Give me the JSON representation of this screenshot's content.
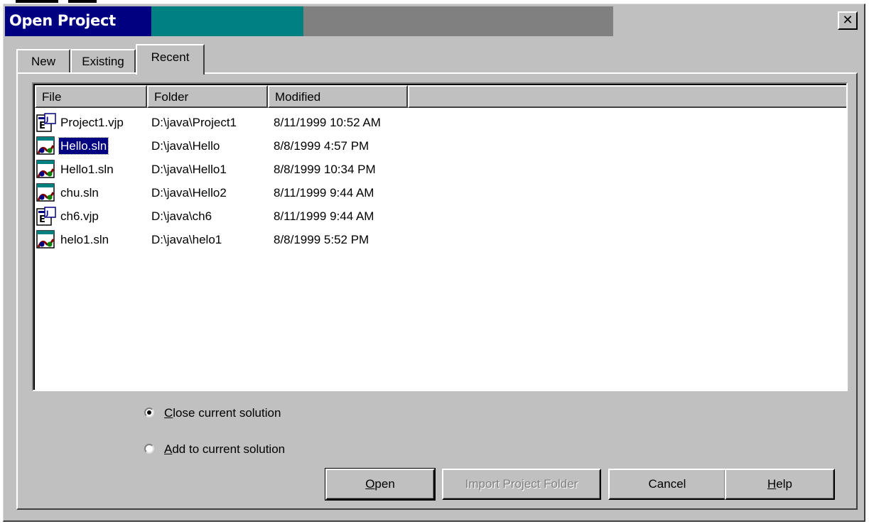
{
  "window": {
    "title": "Open Project",
    "close_glyph": "✕",
    "title_colors": [
      "#000080",
      "#008080",
      "#808080"
    ]
  },
  "tabs": [
    {
      "label": "New",
      "active": false
    },
    {
      "label": "Existing",
      "active": false
    },
    {
      "label": "Recent",
      "active": true
    }
  ],
  "list": {
    "columns": [
      "File",
      "Folder",
      "Modified"
    ],
    "rows": [
      {
        "file": "Project1.vjp",
        "folder": "D:\\java\\Project1",
        "modified": "8/11/1999 10:52 AM",
        "icon": "vjp-project-icon",
        "selected": false
      },
      {
        "file": "Hello.sln",
        "folder": "D:\\java\\Hello",
        "modified": "8/8/1999 4:57 PM",
        "icon": "solution-icon",
        "selected": true
      },
      {
        "file": "Hello1.sln",
        "folder": "D:\\java\\Hello1",
        "modified": "8/8/1999 10:34 PM",
        "icon": "solution-icon",
        "selected": false
      },
      {
        "file": "chu.sln",
        "folder": "D:\\java\\Hello2",
        "modified": "8/11/1999 9:44 AM",
        "icon": "solution-icon",
        "selected": false
      },
      {
        "file": "ch6.vjp",
        "folder": "D:\\java\\ch6",
        "modified": "8/11/1999 9:44 AM",
        "icon": "vjp-project-icon",
        "selected": false
      },
      {
        "file": "helo1.sln",
        "folder": "D:\\java\\helo1",
        "modified": "8/8/1999 5:52 PM",
        "icon": "solution-icon",
        "selected": false
      }
    ]
  },
  "options": {
    "close_current": {
      "underline": "C",
      "rest": "lose current solution",
      "checked": true
    },
    "add_current": {
      "underline": "A",
      "rest": "dd to current solution",
      "checked": false
    }
  },
  "buttons": {
    "open": {
      "underline": "O",
      "rest": "pen"
    },
    "import": {
      "label": "Import Project Folder",
      "enabled": false
    },
    "cancel": {
      "label": "Cancel"
    },
    "help": {
      "underline": "H",
      "rest": "elp"
    }
  }
}
